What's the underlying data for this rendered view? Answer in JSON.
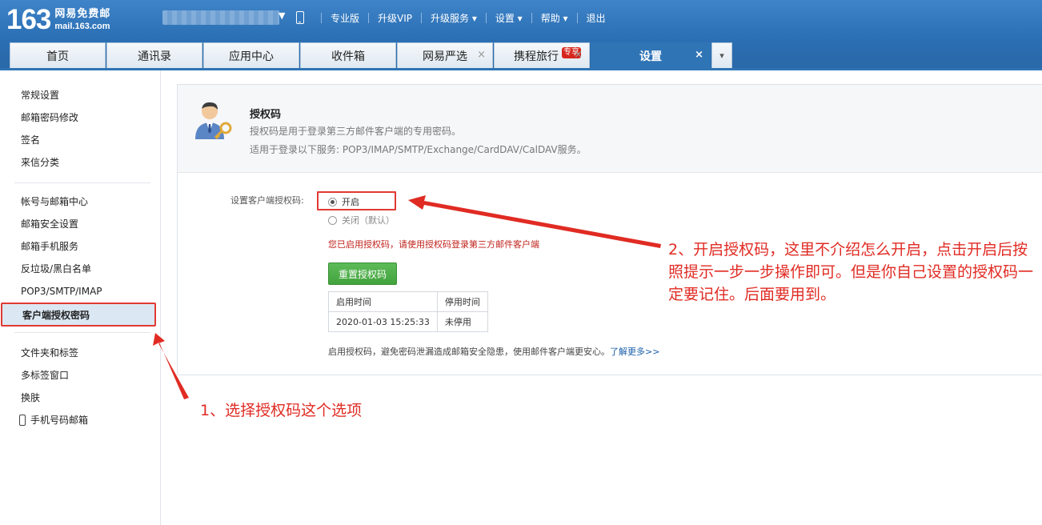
{
  "logo": {
    "number": "163",
    "cn": "网易免费邮",
    "domain": "mail.163.com"
  },
  "topnav": [
    "专业版",
    "升级VIP",
    "升级服务 ▾",
    "设置 ▾",
    "帮助 ▾",
    "退出"
  ],
  "tabs": [
    {
      "label": "首页"
    },
    {
      "label": "通讯录"
    },
    {
      "label": "应用中心"
    },
    {
      "label": "收件箱"
    },
    {
      "label": "网易严选",
      "close": "×"
    },
    {
      "label": "携程旅行",
      "badge": "专享",
      "close": "×"
    },
    {
      "label": "设置",
      "close": "×"
    }
  ],
  "tab_more": "▾",
  "sidebar": {
    "group1": [
      "常规设置",
      "邮箱密码修改",
      "签名",
      "来信分类"
    ],
    "group2": [
      "帐号与邮箱中心",
      "邮箱安全设置",
      "邮箱手机服务",
      "反垃圾/黑白名单",
      "POP3/SMTP/IMAP"
    ],
    "selected": "客户端授权密码",
    "group3": [
      "文件夹和标签",
      "多标签窗口",
      "换肤",
      "手机号码邮箱"
    ]
  },
  "panel": {
    "title": "授权码",
    "desc1": "授权码是用于登录第三方邮件客户端的专用密码。",
    "desc2": "适用于登录以下服务: POP3/IMAP/SMTP/Exchange/CardDAV/CalDAV服务。",
    "form_label": "设置客户端授权码:",
    "option_on": "开启",
    "option_off": "关闭（默认）",
    "notice": "您已启用授权码，请使用授权码登录第三方邮件客户端",
    "reset_button": "重置授权码",
    "table": {
      "headers": [
        "启用时间",
        "停用时间"
      ],
      "row": [
        "2020-01-03 15:25:33",
        "未停用"
      ]
    },
    "footer_text": "启用授权码，避免密码泄漏造成邮箱安全隐患，使用邮件客户端更安心。",
    "footer_link": "了解更多>>"
  },
  "annotations": {
    "step1": "1、选择授权码这个选项",
    "step2": "2、开启授权码，这里不介绍怎么开启，点击开启后按照提示一步一步操作即可。但是你自己设置的授权码一定要记住。后面要用到。",
    "color": "#e02b23"
  }
}
